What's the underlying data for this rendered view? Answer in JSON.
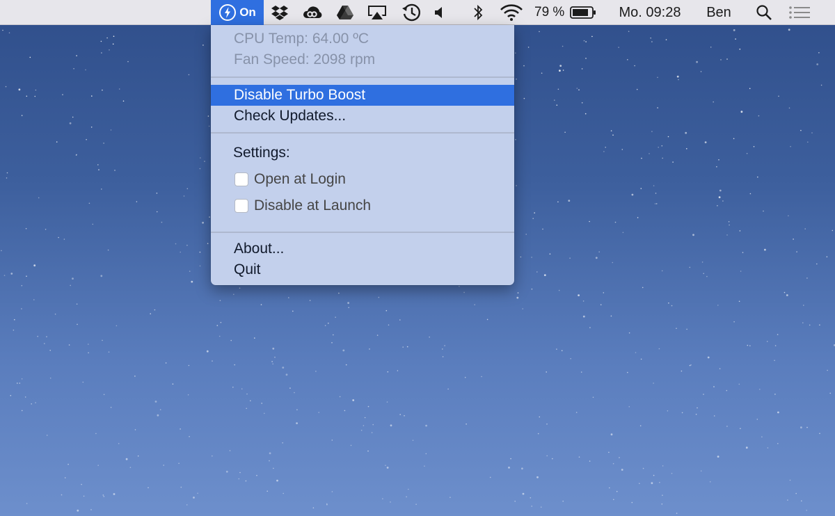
{
  "menubar": {
    "turbo_status": "On",
    "battery_percent": "79 %",
    "clock": "Mo. 09:28",
    "user": "Ben",
    "icons": [
      "turbo-boost-icon",
      "dropbox-icon",
      "creative-cloud-icon",
      "google-drive-icon",
      "airplay-icon",
      "time-machine-icon",
      "volume-icon",
      "bluetooth-icon",
      "wifi-icon",
      "battery-icon",
      "spotlight-icon",
      "notification-center-icon"
    ]
  },
  "menu": {
    "cpu_temp": "CPU Temp: 64.00 ºC",
    "fan_speed": "Fan Speed: 2098 rpm",
    "disable_turbo": "Disable Turbo Boost",
    "check_updates": "Check Updates...",
    "settings_label": "Settings:",
    "open_at_login": "Open at Login",
    "open_at_login_checked": false,
    "disable_at_launch": "Disable at Launch",
    "disable_at_launch_checked": false,
    "about": "About...",
    "quit": "Quit"
  },
  "colors": {
    "highlight": "#2f6fe0",
    "menu_bg": "#c3d0ec",
    "menubar_bg": "#e7e6eb"
  }
}
